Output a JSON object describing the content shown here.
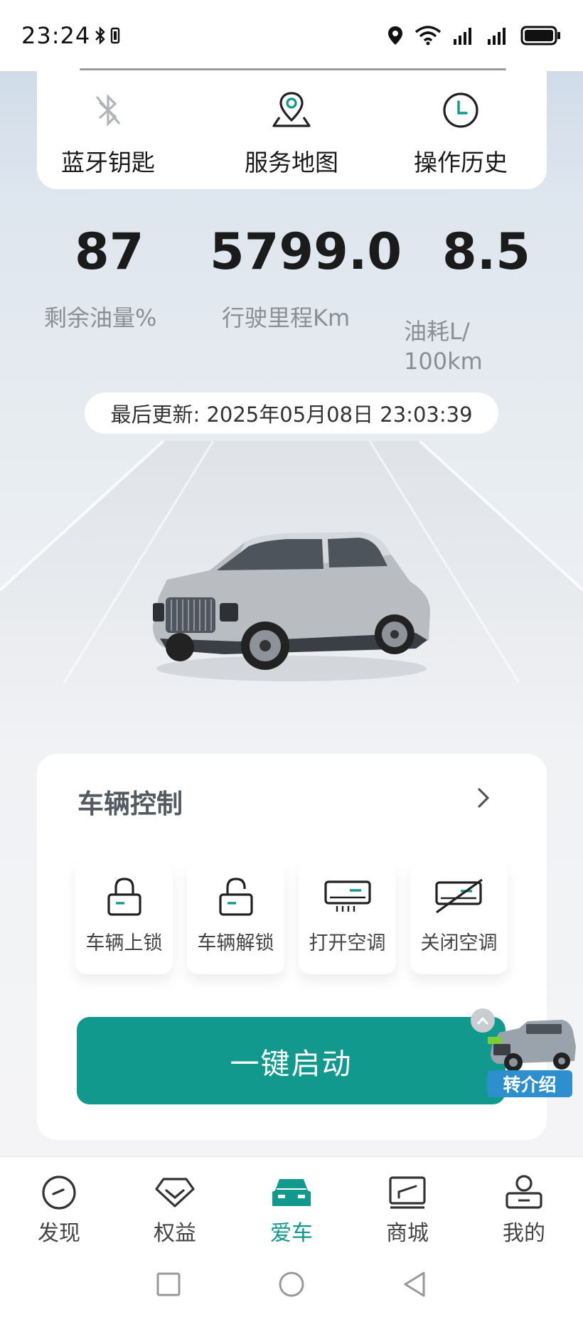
{
  "status_bar": {
    "time": "23:24"
  },
  "quick_actions": [
    {
      "label": "蓝牙钥匙",
      "icon": "bluetooth-icon"
    },
    {
      "label": "服务地图",
      "icon": "map-pin-icon"
    },
    {
      "label": "操作历史",
      "icon": "clock-icon"
    }
  ],
  "stats": [
    {
      "value": "87",
      "label": "剩余油量%"
    },
    {
      "value": "5799.0",
      "label": "行驶里程Km"
    },
    {
      "value": "8.5",
      "label": "油耗L/\n100km"
    }
  ],
  "last_update": "最后更新: 2025年05月08日 23:03:39",
  "vehicle_control": {
    "title": "车辆控制",
    "buttons": [
      {
        "label": "车辆上锁",
        "icon": "lock-icon"
      },
      {
        "label": "车辆解锁",
        "icon": "unlock-icon"
      },
      {
        "label": "打开空调",
        "icon": "ac-on-icon"
      },
      {
        "label": "关闭空调",
        "icon": "ac-off-icon"
      }
    ],
    "start_label": "一键启动"
  },
  "promo": {
    "label": "转介绍"
  },
  "bottom_nav": [
    {
      "label": "发现",
      "icon": "discover-icon",
      "active": false
    },
    {
      "label": "权益",
      "icon": "benefits-icon",
      "active": false
    },
    {
      "label": "爱车",
      "icon": "car-icon",
      "active": true
    },
    {
      "label": "商城",
      "icon": "shop-icon",
      "active": false
    },
    {
      "label": "我的",
      "icon": "profile-icon",
      "active": false
    }
  ],
  "colors": {
    "accent": "#12998e",
    "promo_blue": "#2e8fcf"
  }
}
